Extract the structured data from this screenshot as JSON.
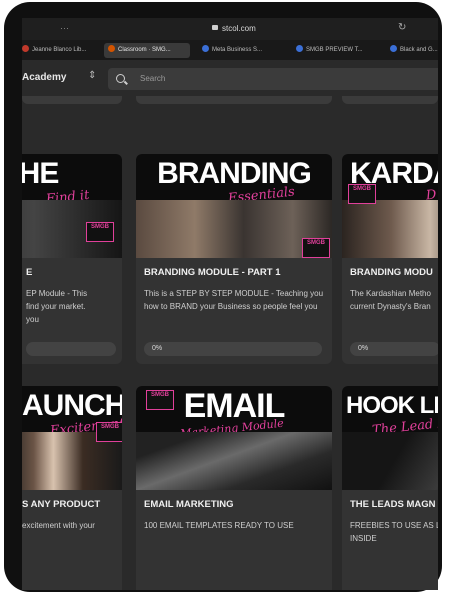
{
  "browser": {
    "url": "stcol.com",
    "tabs": [
      {
        "label": "Jeanne Blanco Lib...",
        "color": "#c0392b",
        "active": false
      },
      {
        "label": "Classroom · SMG...",
        "color": "#d35400",
        "active": true
      },
      {
        "label": "Meta Business S...",
        "color": "#3b6fd6",
        "active": false
      },
      {
        "label": "SMGB PREVIEW T...",
        "color": "#3b6fd6",
        "active": false
      },
      {
        "label": "Black and G...",
        "color": "#3b6fd6",
        "active": false
      }
    ]
  },
  "app": {
    "brand": "s Academy",
    "search_placeholder": "Search"
  },
  "courses": [
    {
      "art_title": "NICHE",
      "art_script": "Find it",
      "title": "E",
      "description": "EP Module - This\nfind your market.\nyou",
      "progress": "",
      "accent": "#e0409a"
    },
    {
      "art_title": "BRANDING",
      "art_script": "Essentials",
      "title": "BRANDING MODULE - PART 1",
      "description": "This is a STEP BY STEP MODULE - Teaching you how to BRAND your Business so people feel you",
      "progress": "0%",
      "accent": "#e0409a"
    },
    {
      "art_title": "KARDA",
      "art_script": "D",
      "title": "BRANDING MODU",
      "description": "The Kardashian Metho current Dynasty's Bran",
      "progress": "0%",
      "accent": "#e0409a"
    },
    {
      "art_title": "AUNCH",
      "art_script": "Excitement",
      "title": "S ANY PRODUCT",
      "description": "excitement with your",
      "progress": "",
      "accent": "#e0409a"
    },
    {
      "art_title": "EMAIL",
      "art_script": "Marketing Module",
      "title": "EMAIL MARKETING",
      "description": "100 EMAIL TEMPLATES READY TO USE",
      "progress": "",
      "accent": "#e0409a"
    },
    {
      "art_title": "HOOK LINE",
      "art_script": "The Lead Magn",
      "title": "THE LEADS MAGN",
      "description": "FREEBIES TO USE AS L INSIDE",
      "progress": "",
      "accent": "#e0409a"
    }
  ],
  "logo_text": "SMGB"
}
